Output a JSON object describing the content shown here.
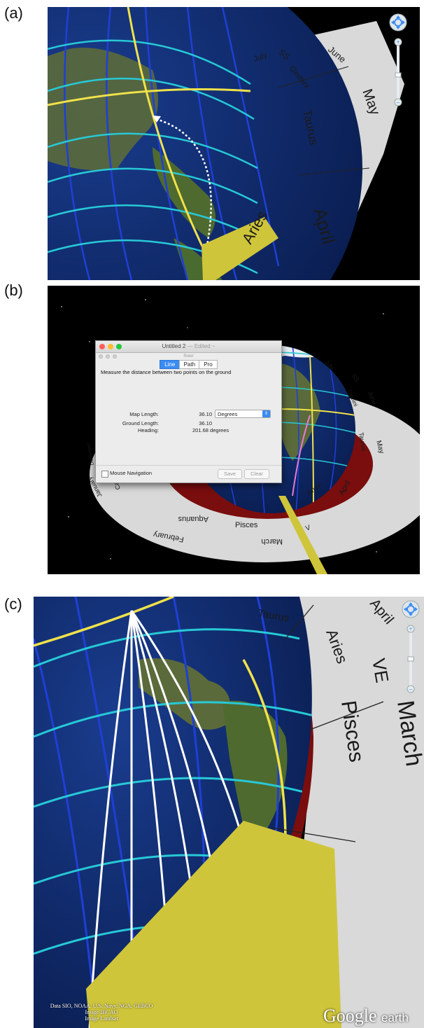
{
  "panels": {
    "a": {
      "label": "(a)",
      "signs": {
        "july": "July",
        "ss": "SS",
        "gemini": "Gemini",
        "june": "June",
        "may": "May",
        "taurus": "Taurus",
        "april": "April",
        "aries": "Aries"
      }
    },
    "b": {
      "label": "(b)",
      "signs": {
        "july": "July",
        "ss": "SS",
        "gemini": "Gemini",
        "june": "June",
        "may": "May",
        "taurus": "Taurus",
        "aries": "Aries",
        "april": "April",
        "pisces": "Pisces",
        "march": "March",
        "aquarius": "Aquarius",
        "february": "February",
        "january": "January",
        "capricorn": "Capricorn",
        "december": "December",
        "s": "S",
        "ve": "V"
      }
    },
    "c": {
      "label": "(c)",
      "signs": {
        "taurus": "Taurus",
        "april": "April",
        "aries": "Aries",
        "ve": "VE",
        "pisces": "Pisces",
        "march": "March"
      }
    }
  },
  "ruler": {
    "window_title": "Untitled 2",
    "window_edited": "— Edited ~",
    "panel_title": "Ruler",
    "tabs": [
      "Line",
      "Path",
      "Pro"
    ],
    "description": "Measure the distance between two points on the ground",
    "map_length_label": "Map Length:",
    "map_length_value": "36.10",
    "unit": "Degrees",
    "ground_length_label": "Ground Length:",
    "ground_length_value": "36.10",
    "heading_label": "Heading:",
    "heading_value": "201.68 degrees",
    "mouse_navigation": "Mouse Navigation",
    "save": "Save",
    "clear": "Clear"
  },
  "attribution": {
    "line1": "Data SIO, NOAA, U.S. Navy, NGA, GEBCO",
    "line2": "Image IBCAO",
    "line3": "Image Landsat"
  },
  "logo": {
    "word": "Google",
    "suffix": "earth"
  },
  "colors": {
    "ocean": "#0f2a6e",
    "meridian": "#1f3fd6",
    "parallel": "#27c9d6",
    "yellow": "#f0e24a",
    "ecliptic_band": "#7a0d0d",
    "zodiac_ring": "#d9d9d9",
    "pillar": "#cfc53a"
  },
  "icons": [
    "nav-compass-icon",
    "zoom-plus-icon",
    "zoom-minus-icon"
  ]
}
